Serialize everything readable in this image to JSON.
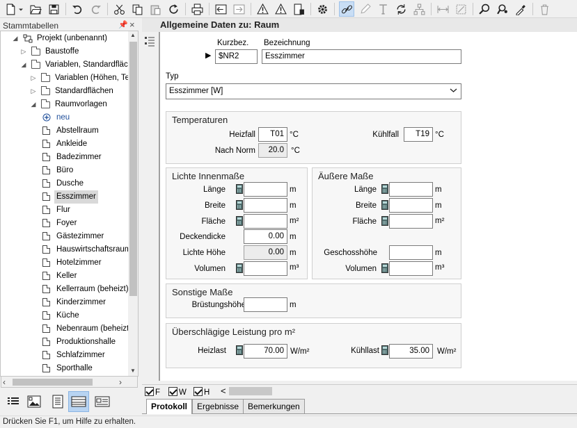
{
  "toolbar": {
    "icons": [
      "new-file-icon",
      "dropdown-arrow-icon",
      "open-folder-icon",
      "save-icon",
      "undo-icon",
      "redo-icon",
      "cut-icon",
      "copy-icon",
      "paste-icon",
      "refresh-icon",
      "print-icon",
      "import-icon",
      "export-icon",
      "warning-icon",
      "warning-list-icon",
      "calculator-check-icon",
      "settings-icon",
      "link-icon",
      "pencil-icon",
      "text-icon",
      "sync-icon",
      "tree-structure-icon",
      "measure-horizontal-icon",
      "resize-icon",
      "search-icon",
      "search-person-icon",
      "eyedropper-icon",
      "delete-icon"
    ]
  },
  "left_pane": {
    "title": "Stammtabellen",
    "pin": "—",
    "close": "×",
    "tree": [
      {
        "label": "Projekt (unbenannt)",
        "level": 0,
        "expander": "◢",
        "icon": "project"
      },
      {
        "label": "Baustoffe",
        "level": 1,
        "expander": "▷",
        "icon": "folder"
      },
      {
        "label": "Variablen, Standardfläche",
        "level": 1,
        "expander": "◢",
        "icon": "folder"
      },
      {
        "label": "Variablen (Höhen, Temp",
        "level": 2,
        "expander": "▷",
        "icon": "folder"
      },
      {
        "label": "Standardflächen",
        "level": 2,
        "expander": "▷",
        "icon": "folder"
      },
      {
        "label": "Raumvorlagen",
        "level": 2,
        "expander": "◢",
        "icon": "folder"
      },
      {
        "label": "neu",
        "level": 3,
        "expander": "",
        "icon": "add",
        "color": "#1f4e9a"
      },
      {
        "label": "Abstellraum",
        "level": 3,
        "expander": "",
        "icon": "doc"
      },
      {
        "label": "Ankleide",
        "level": 3,
        "expander": "",
        "icon": "doc"
      },
      {
        "label": "Badezimmer",
        "level": 3,
        "expander": "",
        "icon": "doc"
      },
      {
        "label": "Büro",
        "level": 3,
        "expander": "",
        "icon": "doc"
      },
      {
        "label": "Dusche",
        "level": 3,
        "expander": "",
        "icon": "doc"
      },
      {
        "label": "Esszimmer",
        "level": 3,
        "expander": "",
        "icon": "doc",
        "selected": true
      },
      {
        "label": "Flur",
        "level": 3,
        "expander": "",
        "icon": "doc"
      },
      {
        "label": "Foyer",
        "level": 3,
        "expander": "",
        "icon": "doc"
      },
      {
        "label": "Gästezimmer",
        "level": 3,
        "expander": "",
        "icon": "doc"
      },
      {
        "label": "Hauswirtschaftsraum",
        "level": 3,
        "expander": "",
        "icon": "doc"
      },
      {
        "label": "Hotelzimmer",
        "level": 3,
        "expander": "",
        "icon": "doc"
      },
      {
        "label": "Keller",
        "level": 3,
        "expander": "",
        "icon": "doc"
      },
      {
        "label": "Kellerraum (beheizt)",
        "level": 3,
        "expander": "",
        "icon": "doc"
      },
      {
        "label": "Kinderzimmer",
        "level": 3,
        "expander": "",
        "icon": "doc"
      },
      {
        "label": "Küche",
        "level": 3,
        "expander": "",
        "icon": "doc"
      },
      {
        "label": "Nebenraum (beheizt)",
        "level": 3,
        "expander": "",
        "icon": "doc"
      },
      {
        "label": "Produktionshalle",
        "level": 3,
        "expander": "",
        "icon": "doc"
      },
      {
        "label": "Schlafzimmer",
        "level": 3,
        "expander": "",
        "icon": "doc"
      },
      {
        "label": "Sporthalle",
        "level": 3,
        "expander": "",
        "icon": "doc"
      }
    ],
    "bottom_buttons": [
      "list-view-icon",
      "image-view-icon",
      "document-view-icon",
      "table-view-icon",
      "card-view-icon"
    ]
  },
  "content": {
    "title": "Allgemeine Daten zu: Raum",
    "kurzbez_label": "Kurzbez.",
    "bezeichnung_label": "Bezeichnung",
    "kurzbez_value": "$NR2",
    "bezeichnung_value": "Esszimmer",
    "typ_label": "Typ",
    "typ_value": "Esszimmer [W]",
    "temperaturen": {
      "title": "Temperaturen",
      "heizfall_label": "Heizfall",
      "heizfall_value": "T01",
      "heizfall_unit": "°C",
      "kuehlfall_label": "Kühlfall",
      "kuehlfall_value": "T19",
      "kuehlfall_unit": "°C",
      "nachnorm_label": "Nach Norm",
      "nachnorm_value": "20.0",
      "nachnorm_unit": "°C"
    },
    "lichte": {
      "title": "Lichte Innenmaße",
      "laenge": "Länge",
      "breite": "Breite",
      "flaeche": "Fläche",
      "deckendicke": "Deckendicke",
      "deckendicke_value": "0.00",
      "lichte_hoehe": "Lichte Höhe",
      "lichte_hoehe_value": "0.00",
      "volumen": "Volumen"
    },
    "aeussere": {
      "title": "Äußere Maße",
      "laenge": "Länge",
      "breite": "Breite",
      "flaeche": "Fläche",
      "geschosshoehe": "Geschosshöhe",
      "volumen": "Volumen"
    },
    "sonstige": {
      "title": "Sonstige Maße",
      "bruestungshoehe": "Brüstungshöhe"
    },
    "leistung": {
      "title": "Überschlägige Leistung pro m²",
      "heizlast_label": "Heizlast",
      "heizlast_value": "70.00",
      "kuehllast_label": "Kühllast",
      "kuehllast_value": "35.00",
      "unit": "W/m²"
    },
    "units": {
      "m": "m",
      "m2": "m²",
      "m3": "m³"
    }
  },
  "bottom": {
    "checks": [
      {
        "label": "F"
      },
      {
        "label": "W"
      },
      {
        "label": "H"
      }
    ],
    "scroll_left": "<",
    "tabs": [
      "Protokoll",
      "Ergebnisse",
      "Bemerkungen"
    ],
    "active_tab": "Protokoll"
  },
  "status": "Drücken Sie F1, um Hilfe zu erhalten."
}
